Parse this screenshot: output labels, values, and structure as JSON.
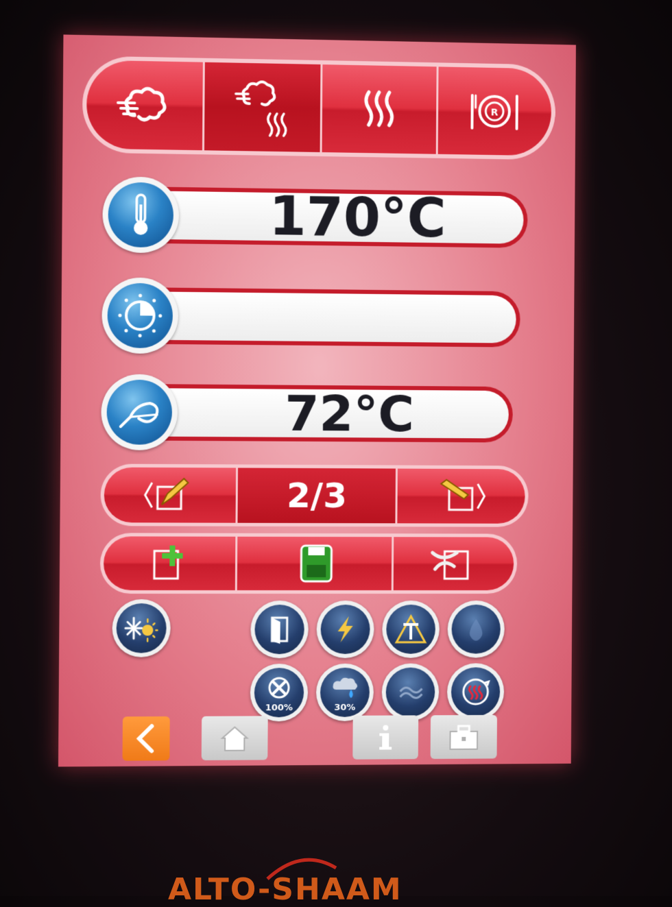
{
  "modes": [
    {
      "icon": "steam-icon",
      "active": false
    },
    {
      "icon": "combi-icon",
      "active": true
    },
    {
      "icon": "convection-icon",
      "active": false
    },
    {
      "icon": "retherm-icon",
      "active": false
    }
  ],
  "settings": {
    "temperature": {
      "icon": "thermometer-icon",
      "value": "170°C"
    },
    "timer": {
      "icon": "timer-icon",
      "value": ""
    },
    "probe": {
      "icon": "probe-icon",
      "value": "72°C"
    }
  },
  "steps": {
    "current_label": "2/3"
  },
  "actions": {
    "add_icon": "add-step-icon",
    "save_icon": "save-icon",
    "delete_icon": "delete-step-icon"
  },
  "options": {
    "row1": [
      "door-icon",
      "power-icon",
      "delta-t-icon",
      "humidity-icon"
    ],
    "row2": [
      {
        "icon": "fan-icon",
        "label": "100%"
      },
      {
        "icon": "rain-icon",
        "label": "30%"
      },
      {
        "icon": "smoke-icon",
        "label": ""
      },
      {
        "icon": "preheat-icon",
        "label": ""
      }
    ]
  },
  "brand": "ALTO-SHAAM",
  "colors": {
    "accent_red": "#c81c2c",
    "bezel_blue": "#2a82c6",
    "back_orange": "#f07a18"
  }
}
